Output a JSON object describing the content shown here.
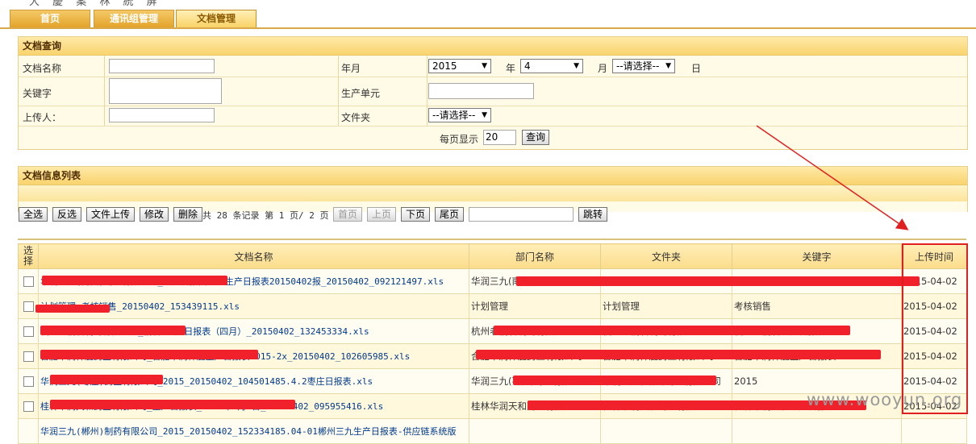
{
  "top_strip": "大 慶 案 林 統 屏",
  "tabs": [
    {
      "label": "首页"
    },
    {
      "label": "通讯组管理"
    },
    {
      "label": "文档管理"
    }
  ],
  "query": {
    "title": "文档查询",
    "doc_name_label": "文档名称",
    "keyword_label": "关键字",
    "uploader_label": "上传人：",
    "year_month_label": "年月",
    "year_value": "2015",
    "year_unit": "年",
    "month_value": "4",
    "month_unit": "月",
    "day_value": "--请选择--",
    "day_unit": "日",
    "unit_label": "生产单元",
    "folder_label": "文件夹",
    "folder_value": "--请选择--",
    "page_size_label": "每页显示",
    "page_size_value": "20",
    "search_button": "查询"
  },
  "list": {
    "title": "文档信息列表",
    "toolbar": {
      "select_all": "全选",
      "invert": "反选",
      "upload": "文件上传",
      "edit": "修改",
      "delete": "删除",
      "summary": "共 28 条记录 第 1 页/ 2 页",
      "first": "首页",
      "prev": "上页",
      "next": "下页",
      "last": "尾页",
      "jump": "跳转"
    },
    "columns": [
      "选择",
      "文档名称",
      "部门名称",
      "文件夹",
      "关键字",
      "上传时间"
    ],
    "rows": [
      {
        "name": "华润三九(南昌)药业有限公司_生产日报昌三九生产日报表20150402报_20150402_092121497.xls",
        "dept": "华润三九(南昌)药业有限公司",
        "folder": "华润三九(南昌)药业有限公司",
        "keyword": "2015年4月南昌三九生产日报表",
        "date": "2015-04-02"
      },
      {
        "name": "计划管理_考核销售_20150402_153439115.xls",
        "dept": "计划管理",
        "folder": "计划管理",
        "keyword": "考核销售",
        "date": "2015-04-02"
      },
      {
        "name": "杭州老桐君制药有限公司_桐君 生产日报表（四月）_20150402_132453334.xls",
        "dept": "杭州老桐君制药有限公司",
        "folder": "杭州老桐君制药有限公司",
        "keyword": "杭州老桐君生产日报表",
        "date": "2015-04-02"
      },
      {
        "name": "合肥华润神鹿药业有限公司_合肥华润神鹿生产日报表2015-2x_20150402_102605985.xls",
        "dept": "合肥华润神鹿药业有限公司",
        "folder": "合肥华润神鹿药业有限公司",
        "keyword": "合肥华润神鹿生产日报表2015-2x",
        "date": "2015-04-02"
      },
      {
        "name": "华润三九(枣庄)药业有限公司_2015_20150402_104501485.4.2枣庄日报表.xls",
        "dept": "华润三九(枣庄)药业有限公司",
        "folder": "华润三九(枣庄)药业有限公司",
        "keyword": "2015",
        "date": "2015-04-02"
      },
      {
        "name": "桂林华润天和药业有限公司_生产日报表_2015年4月1日_20150402_095955416.xls",
        "dept": "桂林华润天和药业有限公司",
        "folder": "桂林华润天和药业有限公司",
        "keyword": "桂林华润天和生产日报表",
        "date": "2015-04-02"
      },
      {
        "name": "华润三九(郴州)制药有限公司_2015_20150402_152334185.04-01郴州三九生产日报表-供应链系统版",
        "dept": "",
        "folder": "",
        "keyword": "",
        "date": ""
      }
    ]
  },
  "watermark": "www.wooyun.org"
}
